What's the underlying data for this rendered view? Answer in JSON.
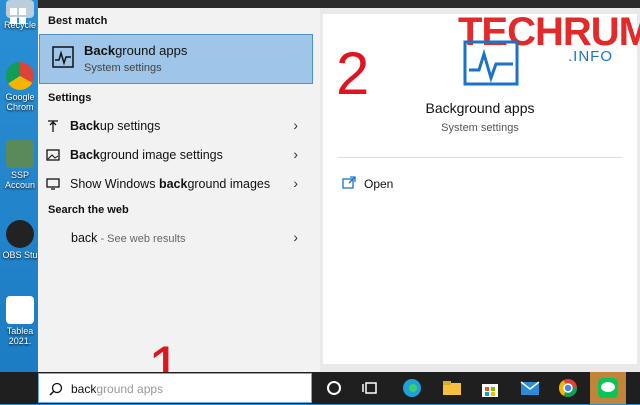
{
  "desktop": {
    "icons": [
      {
        "label": "Recycle"
      },
      {
        "label": "Google Chrom"
      },
      {
        "label": "SSP Accoun"
      },
      {
        "label": "OBS Stu"
      },
      {
        "label": "Tablea 2021."
      }
    ]
  },
  "results": {
    "best_match_heading": "Best match",
    "best_match": {
      "title_bold": "Back",
      "title_rest": "ground apps",
      "subtitle": "System settings"
    },
    "settings_heading": "Settings",
    "settings_items": [
      {
        "bold": "Back",
        "rest": "up settings"
      },
      {
        "bold": "Back",
        "rest": "ground image settings"
      },
      {
        "pre": "Show Windows ",
        "bold": "back",
        "rest": "ground images"
      }
    ],
    "web_heading": "Search the web",
    "web_item": {
      "query": "back",
      "suffix": " - See web results"
    }
  },
  "preview": {
    "title": "Background apps",
    "subtitle": "System settings",
    "open_label": "Open"
  },
  "annotations": {
    "step1": "1",
    "step2": "2"
  },
  "watermark": {
    "brand": "TECHRUM",
    "suffix": ".INFO"
  },
  "search": {
    "typed": "back",
    "completion": "ground apps"
  },
  "colors": {
    "accent_red": "#e0141c",
    "selection_blue": "#9fc5e8"
  }
}
